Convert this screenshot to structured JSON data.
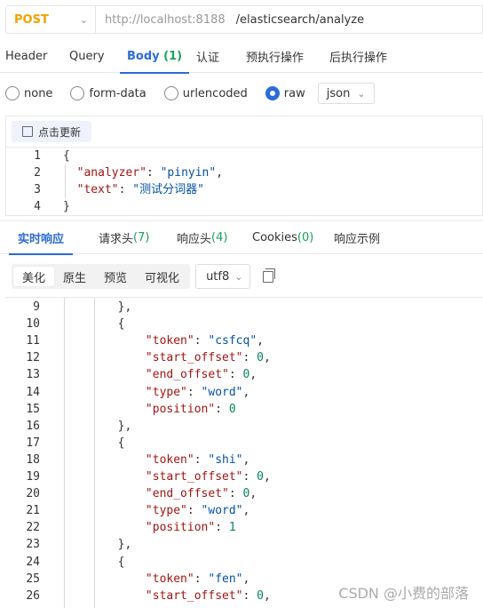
{
  "request": {
    "method": "POST",
    "url_host": "http://localhost:8188",
    "url_path": "/elasticsearch/analyze"
  },
  "request_tabs": [
    {
      "label": "Header"
    },
    {
      "label": "Query"
    },
    {
      "label": "Body",
      "badge": "(1)",
      "active": true
    },
    {
      "label": "认证"
    },
    {
      "label": "预执行操作"
    },
    {
      "label": "后执行操作"
    }
  ],
  "body_types": [
    {
      "label": "none",
      "checked": false
    },
    {
      "label": "form-data",
      "checked": false
    },
    {
      "label": "urlencoded",
      "checked": false
    },
    {
      "label": "raw",
      "checked": true
    }
  ],
  "body_format": "json",
  "refresh_label": "点击更新",
  "request_body_lines": [
    {
      "n": "1",
      "tokens": [
        {
          "t": "{",
          "c": "p"
        }
      ]
    },
    {
      "n": "2",
      "tokens": [
        {
          "t": "  ",
          "c": "p"
        },
        {
          "t": "\"analyzer\"",
          "c": "k"
        },
        {
          "t": ": ",
          "c": "p"
        },
        {
          "t": "\"pinyin\"",
          "c": "s"
        },
        {
          "t": ",",
          "c": "p"
        }
      ]
    },
    {
      "n": "3",
      "tokens": [
        {
          "t": "  ",
          "c": "p"
        },
        {
          "t": "\"text\"",
          "c": "k"
        },
        {
          "t": ": ",
          "c": "p"
        },
        {
          "t": "\"测试分词器\"",
          "c": "s"
        }
      ]
    },
    {
      "n": "4",
      "tokens": [
        {
          "t": "}",
          "c": "p"
        }
      ]
    }
  ],
  "response_tabs": [
    {
      "label": "实时响应",
      "active": true
    },
    {
      "label": "请求头",
      "count": "(7)"
    },
    {
      "label": "响应头",
      "count": "(4)"
    },
    {
      "label": "Cookies",
      "count": "(0)"
    },
    {
      "label": "响应示例"
    }
  ],
  "view_modes": [
    {
      "label": "美化",
      "active": true
    },
    {
      "label": "原生"
    },
    {
      "label": "预览"
    },
    {
      "label": "可视化"
    }
  ],
  "encoding": "utf8",
  "response_lines": [
    {
      "n": "9",
      "tokens": [
        {
          "t": "        },",
          "c": "p"
        }
      ]
    },
    {
      "n": "10",
      "tokens": [
        {
          "t": "        {",
          "c": "p"
        }
      ]
    },
    {
      "n": "11",
      "tokens": [
        {
          "t": "            ",
          "c": "p"
        },
        {
          "t": "\"token\"",
          "c": "k"
        },
        {
          "t": ": ",
          "c": "p"
        },
        {
          "t": "\"csfcq\"",
          "c": "s"
        },
        {
          "t": ",",
          "c": "p"
        }
      ]
    },
    {
      "n": "12",
      "tokens": [
        {
          "t": "            ",
          "c": "p"
        },
        {
          "t": "\"start_offset\"",
          "c": "k"
        },
        {
          "t": ": ",
          "c": "p"
        },
        {
          "t": "0",
          "c": "n"
        },
        {
          "t": ",",
          "c": "p"
        }
      ]
    },
    {
      "n": "13",
      "tokens": [
        {
          "t": "            ",
          "c": "p"
        },
        {
          "t": "\"end_offset\"",
          "c": "k"
        },
        {
          "t": ": ",
          "c": "p"
        },
        {
          "t": "0",
          "c": "n"
        },
        {
          "t": ",",
          "c": "p"
        }
      ]
    },
    {
      "n": "14",
      "tokens": [
        {
          "t": "            ",
          "c": "p"
        },
        {
          "t": "\"type\"",
          "c": "k"
        },
        {
          "t": ": ",
          "c": "p"
        },
        {
          "t": "\"word\"",
          "c": "s"
        },
        {
          "t": ",",
          "c": "p"
        }
      ]
    },
    {
      "n": "15",
      "tokens": [
        {
          "t": "            ",
          "c": "p"
        },
        {
          "t": "\"position\"",
          "c": "k"
        },
        {
          "t": ": ",
          "c": "p"
        },
        {
          "t": "0",
          "c": "n"
        }
      ]
    },
    {
      "n": "16",
      "tokens": [
        {
          "t": "        },",
          "c": "p"
        }
      ]
    },
    {
      "n": "17",
      "tokens": [
        {
          "t": "        {",
          "c": "p"
        }
      ]
    },
    {
      "n": "18",
      "tokens": [
        {
          "t": "            ",
          "c": "p"
        },
        {
          "t": "\"token\"",
          "c": "k"
        },
        {
          "t": ": ",
          "c": "p"
        },
        {
          "t": "\"shi\"",
          "c": "s"
        },
        {
          "t": ",",
          "c": "p"
        }
      ]
    },
    {
      "n": "19",
      "tokens": [
        {
          "t": "            ",
          "c": "p"
        },
        {
          "t": "\"start_offset\"",
          "c": "k"
        },
        {
          "t": ": ",
          "c": "p"
        },
        {
          "t": "0",
          "c": "n"
        },
        {
          "t": ",",
          "c": "p"
        }
      ]
    },
    {
      "n": "20",
      "tokens": [
        {
          "t": "            ",
          "c": "p"
        },
        {
          "t": "\"end_offset\"",
          "c": "k"
        },
        {
          "t": ": ",
          "c": "p"
        },
        {
          "t": "0",
          "c": "n"
        },
        {
          "t": ",",
          "c": "p"
        }
      ]
    },
    {
      "n": "21",
      "tokens": [
        {
          "t": "            ",
          "c": "p"
        },
        {
          "t": "\"type\"",
          "c": "k"
        },
        {
          "t": ": ",
          "c": "p"
        },
        {
          "t": "\"word\"",
          "c": "s"
        },
        {
          "t": ",",
          "c": "p"
        }
      ]
    },
    {
      "n": "22",
      "tokens": [
        {
          "t": "            ",
          "c": "p"
        },
        {
          "t": "\"position\"",
          "c": "k"
        },
        {
          "t": ": ",
          "c": "p"
        },
        {
          "t": "1",
          "c": "n"
        }
      ]
    },
    {
      "n": "23",
      "tokens": [
        {
          "t": "        },",
          "c": "p"
        }
      ]
    },
    {
      "n": "24",
      "tokens": [
        {
          "t": "        {",
          "c": "p"
        }
      ]
    },
    {
      "n": "25",
      "tokens": [
        {
          "t": "            ",
          "c": "p"
        },
        {
          "t": "\"token\"",
          "c": "k"
        },
        {
          "t": ": ",
          "c": "p"
        },
        {
          "t": "\"fen\"",
          "c": "s"
        },
        {
          "t": ",",
          "c": "p"
        }
      ]
    },
    {
      "n": "26",
      "tokens": [
        {
          "t": "            ",
          "c": "p"
        },
        {
          "t": "\"start_offset\"",
          "c": "k"
        },
        {
          "t": ": ",
          "c": "p"
        },
        {
          "t": "0",
          "c": "n"
        },
        {
          "t": ",",
          "c": "p"
        }
      ]
    }
  ],
  "watermark": "CSDN @小费的部落",
  "colors": {
    "accent": "#2c6bd9",
    "method": "#f2a100",
    "count_green": "#19a35b"
  }
}
